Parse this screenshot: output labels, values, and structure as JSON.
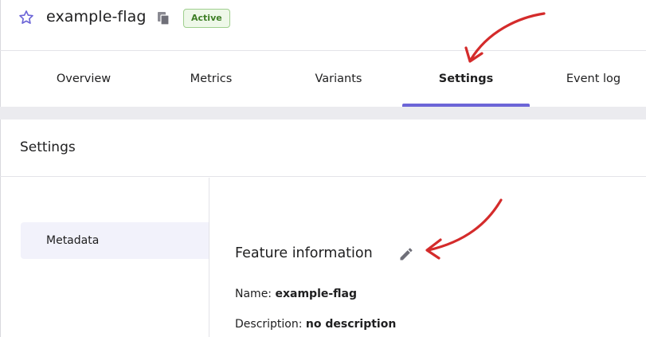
{
  "header": {
    "flag_name": "example-flag",
    "status": "Active",
    "icons": [
      "star-outline-icon",
      "copy-icon"
    ]
  },
  "tabs": [
    {
      "label": "Overview",
      "active": false
    },
    {
      "label": "Metrics",
      "active": false
    },
    {
      "label": "Variants",
      "active": false
    },
    {
      "label": "Settings",
      "active": true
    },
    {
      "label": "Event log",
      "active": false
    }
  ],
  "settings": {
    "title": "Settings",
    "sidebar": {
      "items": [
        {
          "label": "Metadata",
          "selected": true
        }
      ]
    },
    "feature_information": {
      "title": "Feature information",
      "edit_icon": "pencil-icon",
      "name_label": "Name:",
      "name_value": "example-flag",
      "description_label": "Description:",
      "description_value": "no description"
    }
  },
  "colors": {
    "accent": "#6c65d7",
    "badge_bg": "#eef8e9",
    "badge_border": "#9fcf8e",
    "badge_text": "#3f7f27",
    "annotation_arrow": "#d42b2b",
    "sidebar_selected_bg": "#f2f2fb"
  }
}
